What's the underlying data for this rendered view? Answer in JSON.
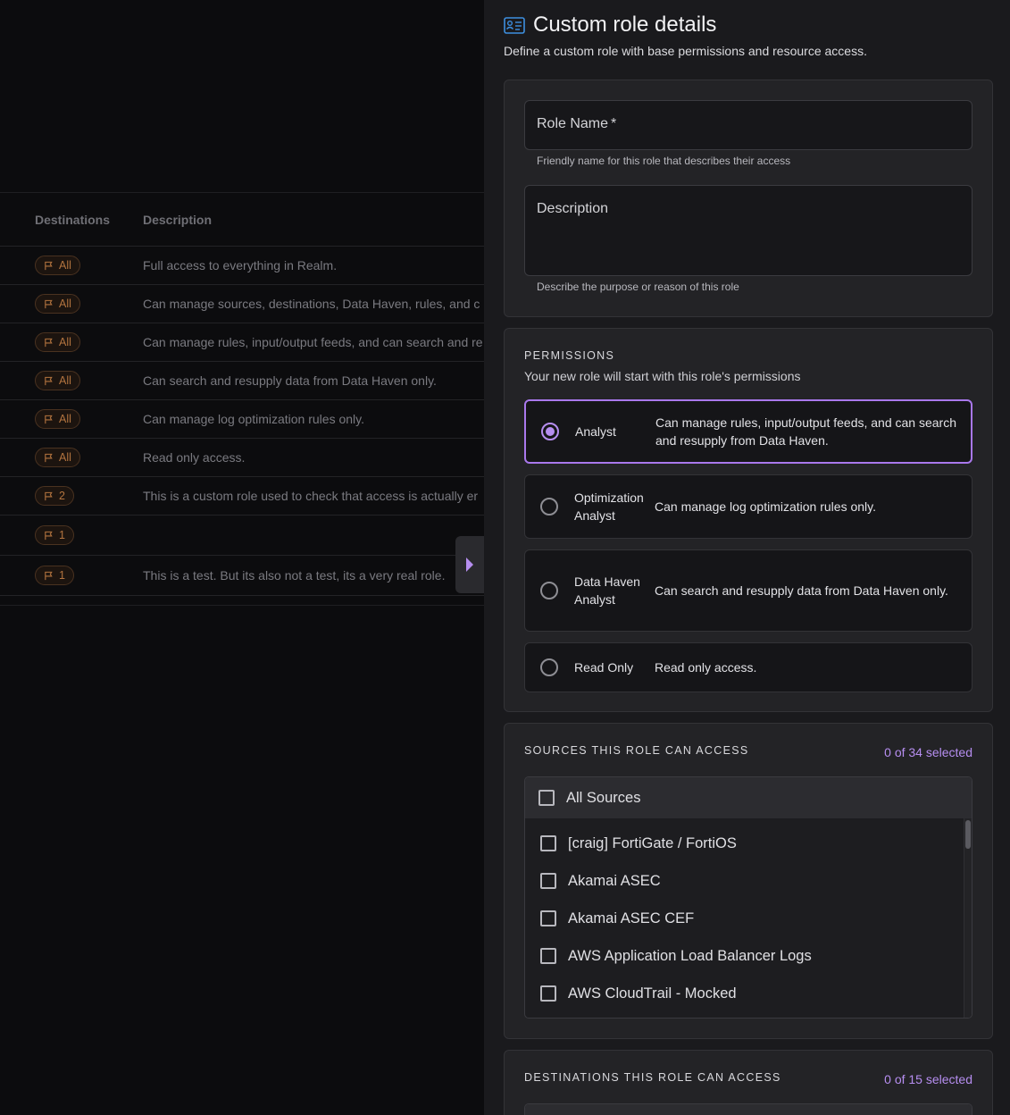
{
  "background_table": {
    "headers": {
      "destinations": "Destinations",
      "description": "Description"
    },
    "rows": [
      {
        "destinations": "All",
        "description": "Full access to everything in Realm."
      },
      {
        "destinations": "All",
        "description": "Can manage sources, destinations, Data Haven, rules, and c"
      },
      {
        "destinations": "All",
        "description": "Can manage rules, input/output feeds, and can search and re"
      },
      {
        "destinations": "All",
        "description": "Can search and resupply data from Data Haven only."
      },
      {
        "destinations": "All",
        "description": "Can manage log optimization rules only."
      },
      {
        "destinations": "All",
        "description": "Read only access."
      },
      {
        "destinations": "2",
        "description": "This is a custom role used to check that access is actually er"
      },
      {
        "destinations": "1",
        "description": ""
      },
      {
        "destinations": "1",
        "description": "This is a test. But its also not a test, its a very real role."
      }
    ]
  },
  "panel": {
    "title": "Custom role details",
    "subtitle": "Define a custom role with base permissions and resource access.",
    "role_name": {
      "label": "Role Name",
      "required_mark": "*",
      "helper": "Friendly name for this role that describes their access"
    },
    "description": {
      "label": "Description",
      "helper": "Describe the purpose or reason of this role"
    },
    "permissions": {
      "label": "PERMISSIONS",
      "hint": "Your new role will start with this role's permissions",
      "options": [
        {
          "name": "Analyst",
          "description": "Can manage rules, input/output feeds, and can search and resupply from Data Haven.",
          "selected": true
        },
        {
          "name": "Optimization Analyst",
          "description": "Can manage log optimization rules only.",
          "selected": false
        },
        {
          "name": "Data Haven Analyst",
          "description": "Can search and resupply data from Data Haven only.",
          "selected": false
        },
        {
          "name": "Read Only",
          "description": "Read only access.",
          "selected": false
        }
      ]
    },
    "sources": {
      "label": "SOURCES THIS ROLE CAN ACCESS",
      "count": "0 of 34 selected",
      "all_label": "All Sources",
      "items": [
        "[craig] FortiGate / FortiOS",
        "Akamai ASEC",
        "Akamai ASEC CEF",
        "AWS Application Load Balancer Logs",
        "AWS CloudTrail - Mocked"
      ]
    },
    "destinations": {
      "label": "DESTINATIONS THIS ROLE CAN ACCESS",
      "count": "0 of 15 selected"
    }
  },
  "colors": {
    "accent": "#b68ef0",
    "chip_text": "#b3743f",
    "panel_bg": "#1a1a1d",
    "title_icon": "#3d8fe0"
  }
}
